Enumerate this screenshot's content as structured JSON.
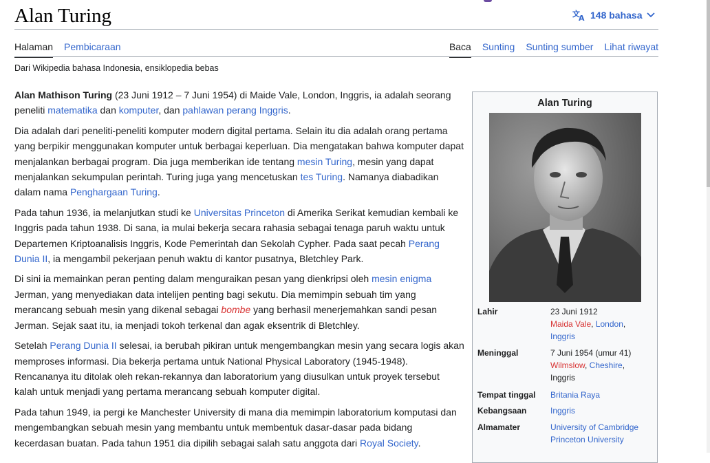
{
  "title": "Alan Turing",
  "languages": {
    "label": "148 bahasa"
  },
  "tabs_left": [
    {
      "label": "Halaman"
    },
    {
      "label": "Pembicaraan"
    }
  ],
  "tabs_right": [
    {
      "label": "Baca"
    },
    {
      "label": "Sunting"
    },
    {
      "label": "Sunting sumber"
    },
    {
      "label": "Lihat riwayat"
    }
  ],
  "tagline": "Dari Wikipedia bahasa Indonesia, ensiklopedia bebas",
  "paragraphs": {
    "p1": {
      "bold": "Alan Mathison Turing",
      "t1": " (23 Juni 1912 – 7 Juni 1954) di Maide Vale, London, Inggris, ia adalah seorang peneliti ",
      "l1": "matematika",
      "t2": " dan ",
      "l2": "komputer",
      "t3": ", dan ",
      "l3": "pahlawan perang Inggris",
      "t4": "."
    },
    "p2": {
      "t1": "Dia adalah dari peneliti-peneliti komputer modern digital pertama. Selain itu dia adalah orang pertama yang berpikir menggunakan komputer untuk berbagai keperluan. Dia mengatakan bahwa komputer dapat menjalankan berbagai program. Dia juga memberikan ide tentang ",
      "l1": "mesin Turing",
      "t2": ", mesin yang dapat menjalankan sekumpulan perintah. Turing juga yang mencetuskan ",
      "l2": "tes Turing",
      "t3": ". Namanya diabadikan dalam nama ",
      "l3": "Penghargaan Turing",
      "t4": "."
    },
    "p3": {
      "t1": "Pada tahun 1936, ia melanjutkan studi ke ",
      "l1": "Universitas Princeton",
      "t2": " di Amerika Serikat kemudian kembali ke Inggris pada tahun 1938. Di sana, ia mulai bekerja secara rahasia sebagai tenaga paruh waktu untuk Departemen Kriptoanalisis Inggris, Kode Pemerintah dan Sekolah Cypher. Pada saat pecah ",
      "l2": "Perang Dunia II",
      "t3": ", ia mengambil pekerjaan penuh waktu di kantor pusatnya, Bletchley Park."
    },
    "p4": {
      "t1": "Di sini ia memainkan peran penting dalam menguraikan pesan yang dienkripsi oleh ",
      "l1": "mesin enigma",
      "t2": " Jerman, yang menyediakan data intelijen penting bagi sekutu. Dia memimpin sebuah tim yang merancang sebuah mesin yang dikenal sebagai ",
      "l2": "bombe",
      "t3": " yang berhasil menerjemahkan sandi pesan Jerman. Sejak saat itu, ia menjadi tokoh terkenal dan agak eksentrik di Bletchley."
    },
    "p5": {
      "t1": "Setelah ",
      "l1": "Perang Dunia II",
      "t2": " selesai, ia berubah pikiran untuk mengembangkan mesin yang secara logis akan memproses informasi. Dia bekerja pertama untuk National Physical Laboratory (1945-1948). Rencananya itu ditolak oleh rekan-rekannya dan laboratorium yang diusulkan untuk proyek tersebut kalah untuk menjadi yang pertama merancang sebuah komputer digital."
    },
    "p6": {
      "t1": "Pada tahun 1949, ia pergi ke Manchester University di mana dia memimpin laboratorium komputasi dan mengembangkan sebuah mesin yang membantu untuk membentuk dasar-dasar pada bidang kecerdasan buatan. Pada tahun 1951 dia dipilih sebagai salah satu anggota dari ",
      "l1": "Royal Society",
      "t2": "."
    }
  },
  "infobox": {
    "title": "Alan Turing",
    "lahir": {
      "key": "Lahir",
      "date": "23 Juni 1912",
      "place1": "Maida Vale",
      "sep": ", ",
      "place2": "London",
      "sep2": ",",
      "place3": "Inggris"
    },
    "meninggal": {
      "key": "Meninggal",
      "date": "7 Juni 1954 (umur 41)",
      "place1": "Wilmslow",
      "sep": ", ",
      "place2": "Cheshire",
      "sep2": ",",
      "place3": "Inggris"
    },
    "tempat": {
      "key": "Tempat tinggal",
      "value": "Britania Raya"
    },
    "kebangsaan": {
      "key": "Kebangsaan",
      "value": "Inggris"
    },
    "almamater": {
      "key": "Almamater",
      "value1": "University of Cambridge",
      "value2": "Princeton University"
    }
  }
}
